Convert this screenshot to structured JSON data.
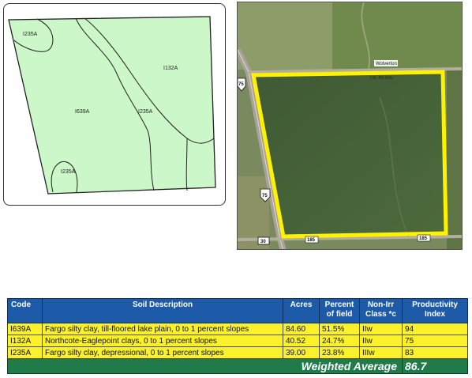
{
  "soil_map": {
    "labels": [
      {
        "id": "i235a-top",
        "text": "I235A"
      },
      {
        "id": "i132a",
        "text": "I132A"
      },
      {
        "id": "i639a",
        "text": "I639A"
      },
      {
        "id": "i235a-mid",
        "text": "I235A"
      },
      {
        "id": "i235a-bottom",
        "text": "I235A"
      }
    ],
    "fill_color": "#ccf7c8",
    "line_color": "#222222"
  },
  "aerial": {
    "road_label": "Wolverton",
    "road_label_2": "GE 49 AVE",
    "sign_75_top": "75",
    "sign_75_bottom": "75",
    "sign_30": "30",
    "sign_185_left": "185",
    "sign_185_right": "185",
    "boundary_color": "#fff200"
  },
  "table": {
    "headers": {
      "code": "Code",
      "description": "Soil Description",
      "acres": "Acres",
      "percent_line1": "Percent",
      "percent_line2": "of field",
      "class_line1": "Non-Irr",
      "class_line2": "Class *c",
      "pi_line1": "Productivity",
      "pi_line2": "Index"
    },
    "rows": [
      {
        "code": "I639A",
        "description": "Fargo silty clay, till-floored lake plain, 0 to 1 percent slopes",
        "acres": "84.60",
        "percent": "51.5%",
        "class": "IIw",
        "pi": "94"
      },
      {
        "code": "I132A",
        "description": "Northcote-Eaglepoint clays, 0 to 1 percent slopes",
        "acres": "40.52",
        "percent": "24.7%",
        "class": "IIw",
        "pi": "75"
      },
      {
        "code": "I235A",
        "description": "Fargo silty clay, depressional, 0 to 1 percent slopes",
        "acres": "39.00",
        "percent": "23.8%",
        "class": "IIIw",
        "pi": "83"
      }
    ],
    "weighted_average_label": "Weighted Average",
    "weighted_average_value": "86.7"
  }
}
